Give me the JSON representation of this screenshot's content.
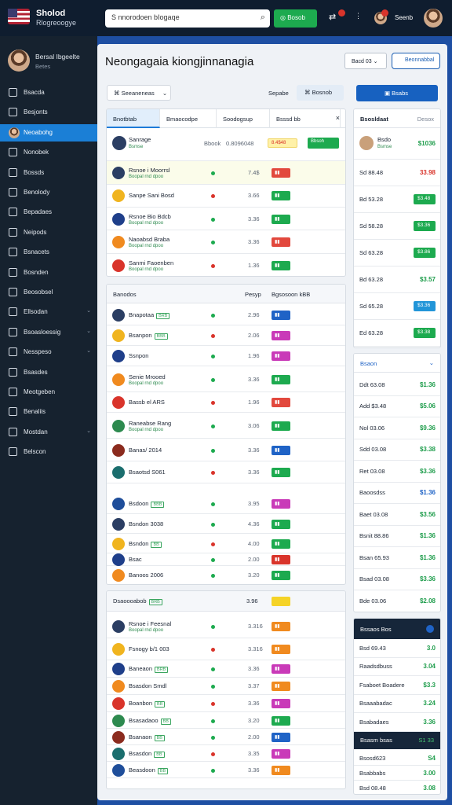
{
  "brand": {
    "title": "Sholod",
    "subtitle": "Rlogreoogye"
  },
  "search": {
    "placeholder": "S nnorodoen bIogaqe"
  },
  "topbar": {
    "go_label": "Bosob",
    "user_name": "Seenb"
  },
  "profile": {
    "name": "Bersal Ibgeelte",
    "sub": "Betes"
  },
  "nav": [
    {
      "label": "Bsacda",
      "icon": "home-icon"
    },
    {
      "label": "Besjonts",
      "icon": "grid-icon"
    },
    {
      "label": "Neoabohg",
      "icon": "avatar",
      "active": true
    },
    {
      "label": "Nonobek",
      "icon": "inbox-icon"
    },
    {
      "label": "Bossds",
      "icon": "bell-icon"
    },
    {
      "label": "Benolody",
      "icon": "calendar-icon"
    },
    {
      "label": "Bepadaes",
      "icon": "chart-icon"
    },
    {
      "label": "Neipods",
      "icon": "user-icon"
    },
    {
      "label": "Bsnacets",
      "icon": "settings-icon"
    },
    {
      "label": "Bosnden",
      "icon": "folder-icon"
    },
    {
      "label": "Beosobsel",
      "icon": "report-icon"
    },
    {
      "label": "Ellsodan",
      "icon": "layers-icon",
      "chevron": true
    },
    {
      "label": "Bsoasloessig",
      "icon": "shield-icon",
      "chevron": true
    },
    {
      "label": "Nesspeso",
      "icon": "tag-icon",
      "chevron": true
    },
    {
      "label": "Bsasdes",
      "icon": "cart-icon"
    },
    {
      "label": "Meotgeben",
      "icon": "mail-icon"
    },
    {
      "label": "Benaliis",
      "icon": "cloud-icon"
    },
    {
      "label": "Mostdan",
      "icon": "box-icon",
      "chevron": true
    },
    {
      "label": "Belscon",
      "icon": "exit-icon"
    }
  ],
  "main": {
    "title": "Neongagaia kiongjinnanagia",
    "head_btn1": "Bacd 03",
    "head_btn2": "Beonnabbal",
    "filter": "Seeaneneas",
    "filter_label": "Sepabe",
    "tab2": "Bosnob",
    "primary": "Bsabs"
  },
  "panel1": {
    "tabs": [
      "Bnotbtab",
      "Bmaocodpe",
      "Soodogsup",
      "Bsssd bb"
    ],
    "top_row": {
      "name": "Sanrage",
      "sub": "Bsmse",
      "v1": "Bbook",
      "v2": "0.8096048",
      "pill": "8.4$48",
      "btn": "Bbsoh"
    },
    "rows": [
      {
        "name": "Rsnoe i Moorrsl",
        "sub": "Boopal rnd dpoo",
        "val": "7.4$",
        "color": "#e2483d"
      },
      {
        "name": "Sanpe Sani Bosd",
        "sub": "",
        "val": "3.66",
        "color": "#1daa4f"
      },
      {
        "name": "Rsnoe Bio Bdcb",
        "sub": "Boopal rnd dpoo",
        "val": "3.36",
        "color": "#1daa4f"
      },
      {
        "name": "Naoabsd Braba",
        "sub": "Boopal rnd dpoo",
        "val": "3.36",
        "color": "#e2483d"
      },
      {
        "name": "Sanmi Faoenben",
        "sub": "Boopal rnd dpoo",
        "val": "1.36",
        "color": "#1daa4f"
      }
    ]
  },
  "panel2": {
    "header": "Banodos",
    "col1": "Pesyp",
    "col2": "Bgsosoon kBB",
    "rows": [
      {
        "name": "Bnapotaa",
        "tag": "BRB",
        "val": "2.96",
        "color": "#1f63c6"
      },
      {
        "name": "Bsanpon",
        "tag": "BBB",
        "val": "2.06",
        "color": "#c93ab8"
      },
      {
        "name": "Ssnpon",
        "tag": "",
        "val": "1.96",
        "color": "#c93ab8"
      },
      {
        "name": "Senie Mrooed",
        "sub": "Boopal rnd dpoo",
        "val": "3.36",
        "color": "#1daa4f"
      },
      {
        "name": "Bassb el ARS",
        "val": "1.96",
        "color": "#e2483d"
      },
      {
        "name": "Raneabse Rang",
        "sub": "Boopal rnd dpoo",
        "val": "3.06",
        "color": "#1daa4f"
      },
      {
        "name": "Banas/ 2014",
        "val": "3.36",
        "color": "#1f63c6"
      },
      {
        "name": "Bsaotsd S061",
        "val": "3.36",
        "color": "#1daa4f"
      },
      {
        "name": "Bsdoon",
        "tag": "BBB",
        "val": "3.95",
        "color": "#c93ab8"
      },
      {
        "name": "Bsndon 3038",
        "val": "4.36",
        "color": "#1daa4f"
      },
      {
        "name": "Bsndon",
        "tag": "BB",
        "val": "4.00",
        "color": "#1daa4f"
      },
      {
        "name": "Bsac",
        "val": "2.00",
        "color": "#d9342b"
      },
      {
        "name": "Banoos 2006",
        "val": "3.20",
        "color": "#1daa4f"
      }
    ]
  },
  "panel3": {
    "header": "Dsaoooabob",
    "tag": "BRB",
    "head_val": "3.96",
    "rows": [
      {
        "name": "Rsnoe i Feesnal",
        "sub": "Boopal rnd dpoo",
        "val": "3.316",
        "color": "#f08a1f"
      },
      {
        "name": "Fsnogy b/1 003",
        "val": "3.316",
        "color": "#f08a1f"
      },
      {
        "name": "Baneaon",
        "tag": "BRB",
        "val": "3.36",
        "color": "#c93ab8"
      },
      {
        "name": "Bsasdon Smdl",
        "val": "3.37",
        "color": "#f08a1f"
      },
      {
        "name": "Boanbon",
        "tag": "BB",
        "val": "3.36",
        "color": "#c93ab8"
      },
      {
        "name": "Bsasadaoo",
        "tag": "BB",
        "val": "3.20",
        "color": "#1daa4f"
      },
      {
        "name": "Bsanaon",
        "tag": "BB",
        "val": "2.00",
        "color": "#1f63c6"
      },
      {
        "name": "Bsasdon",
        "tag": "BB",
        "val": "3.35",
        "color": "#c93ab8"
      },
      {
        "name": "Beasdoon",
        "tag": "BB",
        "val": "3.36",
        "color": "#f08a1f"
      }
    ]
  },
  "right1": {
    "header": "Bsosldaat",
    "header_r": "Desox",
    "top": {
      "name": "Bsdo",
      "sub": "Bsmse",
      "val": "$1036"
    },
    "rows": [
      {
        "label": "Sd 88.48",
        "val": "33.98",
        "red": true
      },
      {
        "label": "Bd 53.28",
        "val": "$3.48",
        "pill": "#1daa4f"
      },
      {
        "label": "Sd 58.28",
        "val": "$3.36",
        "pill": "#1daa4f"
      },
      {
        "label": "Sd 63.28",
        "val": "$3.86",
        "pill": "#1daa4f"
      },
      {
        "label": "Bd 63.28",
        "val": "$3.57"
      },
      {
        "label": "Sd 65.28",
        "val": "$3.36",
        "pill": "#2295d8"
      },
      {
        "label": "Ed 63.28",
        "val": "$3.38",
        "pill": "#1daa4f"
      }
    ]
  },
  "right2": {
    "header": "Bsaon",
    "rows": [
      {
        "label": "Ddt 63.08",
        "val": "$1.36"
      },
      {
        "label": "Add $3.48",
        "val": "$5.06"
      },
      {
        "label": "Nol 03.06",
        "val": "$9.36"
      },
      {
        "label": "Sdd 03.08",
        "val": "$3.38"
      },
      {
        "label": "Ret 03.08",
        "val": "$3.36"
      },
      {
        "label": "Baoosdss",
        "val": "$1.36",
        "blue": true
      },
      {
        "label": "Baet 03.08",
        "val": "$3.56"
      },
      {
        "label": "Bsnit 88.86",
        "val": "$1.36"
      },
      {
        "label": "Bsan 65.93",
        "val": "$1.36"
      },
      {
        "label": "Bsad 03.08",
        "val": "$3.36"
      },
      {
        "label": "Bde 03.06",
        "val": "$2.08"
      }
    ]
  },
  "right3": {
    "header": "Bssaos Bos",
    "rows": [
      {
        "label": "Bsd 69.43",
        "val": "3.0"
      },
      {
        "label": "Raadsdbuss",
        "val": "3.04"
      },
      {
        "label": "Fsaboet Boadere",
        "val": "$3.3"
      },
      {
        "label": "Bsaaabadac",
        "val": "3.24"
      },
      {
        "label": "Bsabadaes",
        "val": "3.36"
      }
    ],
    "dark_row": {
      "label": "Bsasm bsas",
      "val": "S1 33"
    },
    "rows2": [
      {
        "label": "Bsosd623",
        "val": "S4"
      },
      {
        "label": "Bsabbabs",
        "val": "3.00"
      },
      {
        "label": "Bsd 08.48",
        "val": "3.08"
      }
    ]
  }
}
